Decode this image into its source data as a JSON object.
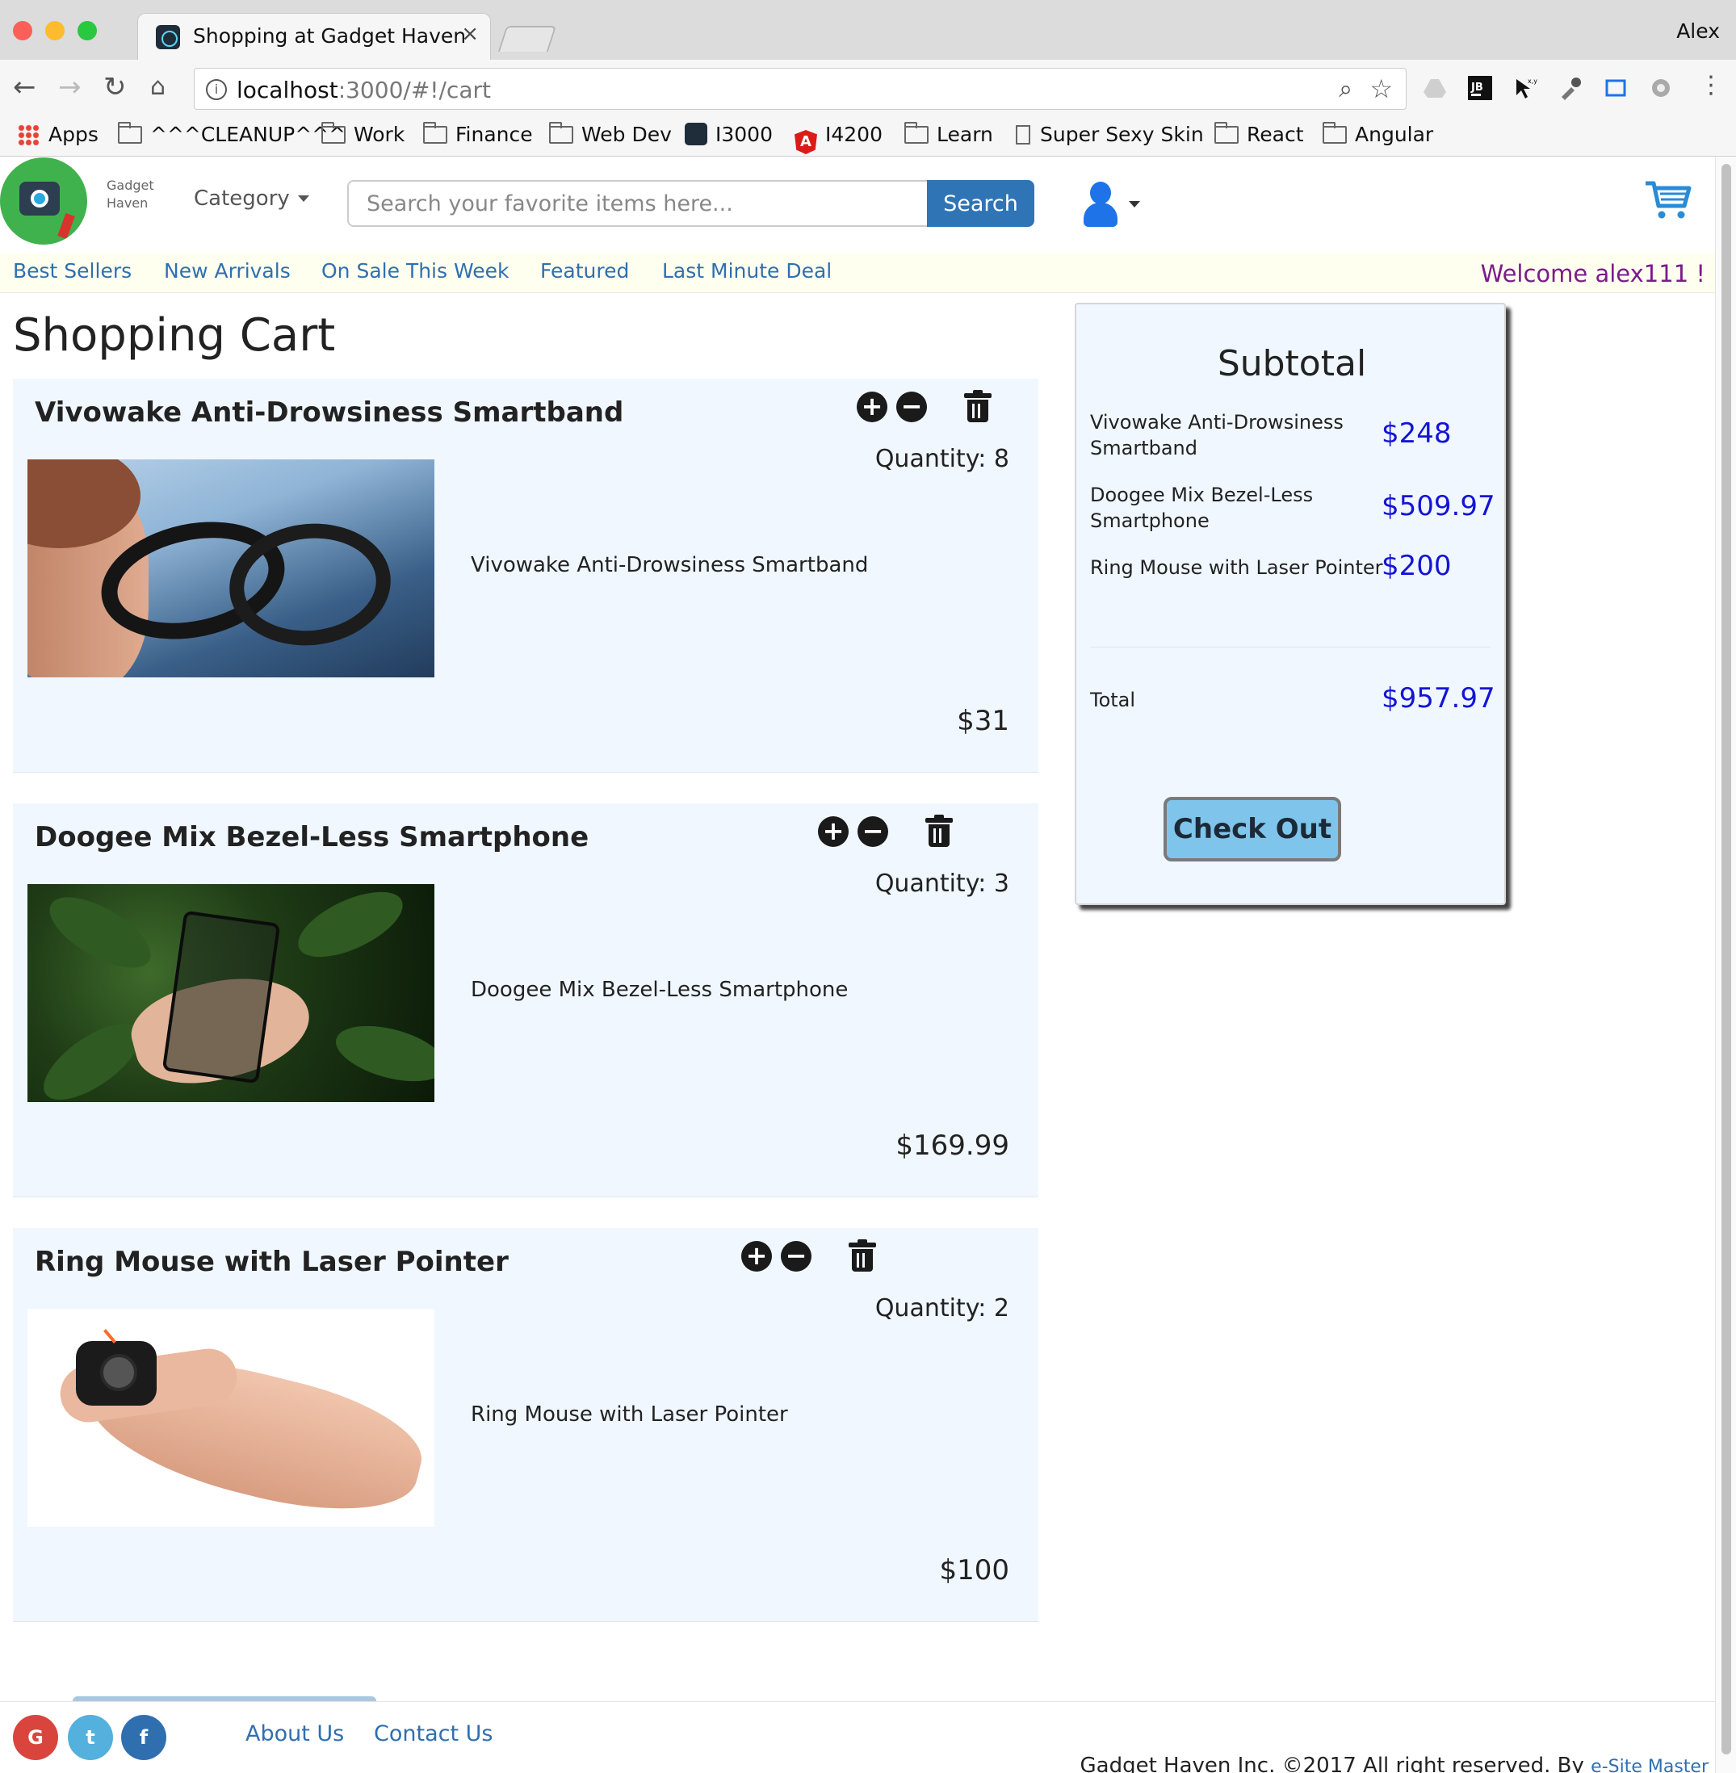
{
  "browser": {
    "tab_title": "Shopping at Gadget Haven",
    "profile_name": "Alex",
    "url_host": "localhost",
    "url_path": ":3000/#!/cart",
    "bookmarks": [
      {
        "label": "Apps",
        "icon": "apps-grid-icon"
      },
      {
        "label": "^^^CLEANUP^^^",
        "icon": "folder-icon"
      },
      {
        "label": "Work",
        "icon": "folder-icon"
      },
      {
        "label": "Finance",
        "icon": "folder-icon"
      },
      {
        "label": "Web Dev",
        "icon": "folder-icon"
      },
      {
        "label": "I3000",
        "icon": "react-icon"
      },
      {
        "label": "I4200",
        "icon": "angular-icon"
      },
      {
        "label": "Learn",
        "icon": "folder-icon"
      },
      {
        "label": "Super Sexy Skin",
        "icon": "page-icon"
      },
      {
        "label": "React",
        "icon": "folder-icon"
      },
      {
        "label": "Angular",
        "icon": "folder-icon"
      }
    ]
  },
  "header": {
    "brand_line1": "Gadget",
    "brand_line2": "Haven",
    "category_label": "Category",
    "search_placeholder": "Search your favorite items here...",
    "search_button": "Search"
  },
  "subnav": {
    "links": [
      "Best Sellers",
      "New Arrivals",
      "On Sale This Week",
      "Featured",
      "Last Minute Deal"
    ],
    "welcome": "Welcome alex111 !"
  },
  "cart": {
    "title": "Shopping Cart",
    "items": [
      {
        "name": "Vivowake Anti-Drowsiness Smartband",
        "quantity_text": "Quantity: 8",
        "description": "Vivowake Anti-Drowsiness Smartband",
        "price": "$31"
      },
      {
        "name": "Doogee Mix Bezel-Less Smartphone",
        "quantity_text": "Quantity: 3",
        "description": "Doogee Mix Bezel-Less Smartphone",
        "price": "$169.99"
      },
      {
        "name": "Ring Mouse with Laser Pointer",
        "quantity_text": "Quantity: 2",
        "description": "Ring Mouse with Laser Pointer",
        "price": "$100"
      }
    ]
  },
  "summary": {
    "title": "Subtotal",
    "lines": [
      {
        "name": "Vivowake Anti-Drowsiness Smartband",
        "amount": "$248"
      },
      {
        "name": "Doogee Mix Bezel-Less Smartphone",
        "amount": "$509.97"
      },
      {
        "name": "Ring Mouse with Laser Pointer",
        "amount": "$200"
      }
    ],
    "total_label": "Total",
    "total_amount": "$957.97",
    "checkout_label": "Check Out"
  },
  "footer": {
    "social": [
      "G",
      "t",
      "f"
    ],
    "links": [
      "About Us",
      "Contact Us"
    ],
    "copyright": "Gadget Haven Inc. ©2017 All right reserved. By",
    "credit_link": "e-Site Master"
  },
  "colors": {
    "accent_blue": "#2f74b5",
    "link_blue": "#2f6fb0",
    "price_blue": "#1414d6",
    "welcome_purple": "#7a1c8a",
    "card_background": "#f0f7ff",
    "checkout_button": "#7fc4ea"
  }
}
